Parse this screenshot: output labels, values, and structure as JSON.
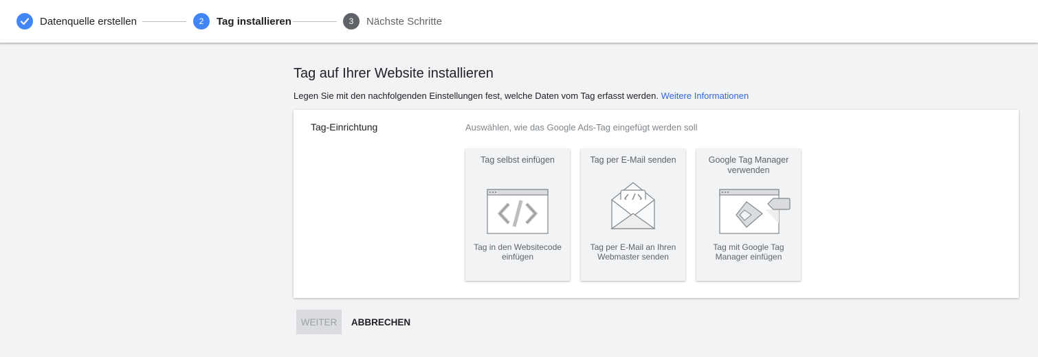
{
  "stepper": {
    "steps": [
      {
        "label": "Datenquelle erstellen",
        "number": "",
        "state": "done",
        "icon": "checkmark-icon"
      },
      {
        "label": "Tag installieren",
        "number": "2",
        "state": "active"
      },
      {
        "label": "Nächste Schritte",
        "number": "3",
        "state": "upcoming"
      }
    ]
  },
  "main": {
    "title": "Tag auf Ihrer Website installieren",
    "subtitle": "Legen Sie mit den nachfolgenden Einstellungen fest, welche Daten vom Tag erfasst werden.",
    "more_link": "Weitere Informationen",
    "section_label": "Tag-Einrichtung",
    "section_hint": "Auswählen, wie das Google Ads-Tag eingefügt werden soll",
    "options": [
      {
        "title": "Tag selbst einfügen",
        "description": "Tag in den Websitecode einfügen",
        "icon": "code-window-icon"
      },
      {
        "title": "Tag per E-Mail senden",
        "description": "Tag per E-Mail an Ihren Webmaster senden",
        "icon": "email-code-icon"
      },
      {
        "title": "Google Tag Manager verwenden",
        "description": "Tag mit Google Tag Manager einfügen",
        "icon": "tag-manager-icon"
      }
    ]
  },
  "actions": {
    "next_label": "WEITER",
    "cancel_label": "ABBRECHEN"
  },
  "colors": {
    "accent": "#4285f4",
    "link": "#3367d6",
    "background": "#f1f3f4"
  }
}
